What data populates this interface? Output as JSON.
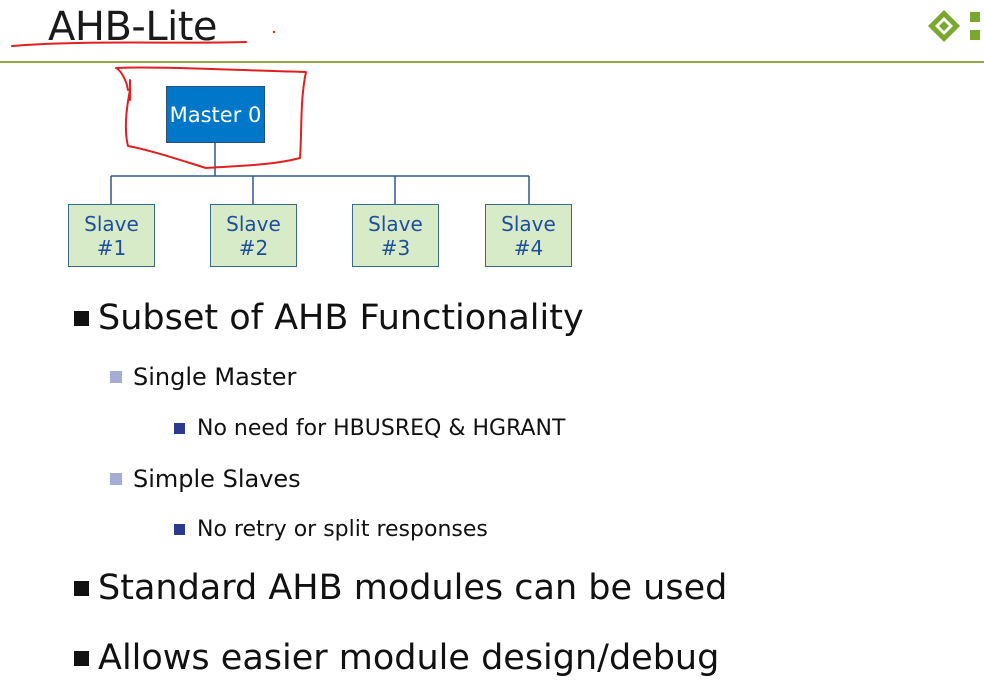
{
  "slide": {
    "title": "AHB-Lite"
  },
  "diagram": {
    "master_label": "Master 0",
    "slaves": [
      {
        "line1": "Slave",
        "line2": "#1"
      },
      {
        "line1": "Slave",
        "line2": "#2"
      },
      {
        "line1": "Slave",
        "line2": "#3"
      },
      {
        "line1": "Slave",
        "line2": "#4"
      }
    ]
  },
  "bullets": {
    "subset": "Subset of AHB Functionality",
    "single_master": "Single Master",
    "no_need": "No need for HBUSREQ & HGRANT",
    "simple_slaves": "Simple Slaves",
    "no_retry": "No retry or split responses",
    "standard": "Standard AHB modules can be used",
    "allows": "Allows easier module design/debug"
  },
  "colors": {
    "master_fill": "#0077c8",
    "slave_fill": "#d7ebc9",
    "slave_text": "#1f4e9a",
    "header_rule": "#8fa94a",
    "annotation_ink": "#e02020"
  },
  "icons": {
    "logo": "diamond-logo-icon"
  }
}
